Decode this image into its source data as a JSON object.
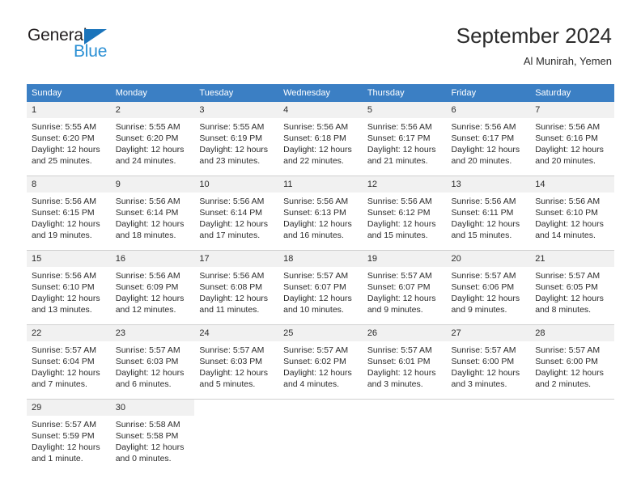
{
  "brand": {
    "name_part1": "General",
    "name_part2": "Blue",
    "triangle_color": "#1a74bb",
    "blue_color": "#2a8fd4"
  },
  "header": {
    "title": "September 2024",
    "subtitle": "Al Munirah, Yemen"
  },
  "theme": {
    "header_row_bg": "#3b7fc4",
    "daynum_bg": "#f1f1f1",
    "text_color": "#2b2b2b",
    "separator_color": "#d0d0d0"
  },
  "weekday_headers": [
    "Sunday",
    "Monday",
    "Tuesday",
    "Wednesday",
    "Thursday",
    "Friday",
    "Saturday"
  ],
  "weeks": [
    [
      {
        "day": "1",
        "sunrise": "Sunrise: 5:55 AM",
        "sunset": "Sunset: 6:20 PM",
        "daylight1": "Daylight: 12 hours",
        "daylight2": "and 25 minutes."
      },
      {
        "day": "2",
        "sunrise": "Sunrise: 5:55 AM",
        "sunset": "Sunset: 6:20 PM",
        "daylight1": "Daylight: 12 hours",
        "daylight2": "and 24 minutes."
      },
      {
        "day": "3",
        "sunrise": "Sunrise: 5:55 AM",
        "sunset": "Sunset: 6:19 PM",
        "daylight1": "Daylight: 12 hours",
        "daylight2": "and 23 minutes."
      },
      {
        "day": "4",
        "sunrise": "Sunrise: 5:56 AM",
        "sunset": "Sunset: 6:18 PM",
        "daylight1": "Daylight: 12 hours",
        "daylight2": "and 22 minutes."
      },
      {
        "day": "5",
        "sunrise": "Sunrise: 5:56 AM",
        "sunset": "Sunset: 6:17 PM",
        "daylight1": "Daylight: 12 hours",
        "daylight2": "and 21 minutes."
      },
      {
        "day": "6",
        "sunrise": "Sunrise: 5:56 AM",
        "sunset": "Sunset: 6:17 PM",
        "daylight1": "Daylight: 12 hours",
        "daylight2": "and 20 minutes."
      },
      {
        "day": "7",
        "sunrise": "Sunrise: 5:56 AM",
        "sunset": "Sunset: 6:16 PM",
        "daylight1": "Daylight: 12 hours",
        "daylight2": "and 20 minutes."
      }
    ],
    [
      {
        "day": "8",
        "sunrise": "Sunrise: 5:56 AM",
        "sunset": "Sunset: 6:15 PM",
        "daylight1": "Daylight: 12 hours",
        "daylight2": "and 19 minutes."
      },
      {
        "day": "9",
        "sunrise": "Sunrise: 5:56 AM",
        "sunset": "Sunset: 6:14 PM",
        "daylight1": "Daylight: 12 hours",
        "daylight2": "and 18 minutes."
      },
      {
        "day": "10",
        "sunrise": "Sunrise: 5:56 AM",
        "sunset": "Sunset: 6:14 PM",
        "daylight1": "Daylight: 12 hours",
        "daylight2": "and 17 minutes."
      },
      {
        "day": "11",
        "sunrise": "Sunrise: 5:56 AM",
        "sunset": "Sunset: 6:13 PM",
        "daylight1": "Daylight: 12 hours",
        "daylight2": "and 16 minutes."
      },
      {
        "day": "12",
        "sunrise": "Sunrise: 5:56 AM",
        "sunset": "Sunset: 6:12 PM",
        "daylight1": "Daylight: 12 hours",
        "daylight2": "and 15 minutes."
      },
      {
        "day": "13",
        "sunrise": "Sunrise: 5:56 AM",
        "sunset": "Sunset: 6:11 PM",
        "daylight1": "Daylight: 12 hours",
        "daylight2": "and 15 minutes."
      },
      {
        "day": "14",
        "sunrise": "Sunrise: 5:56 AM",
        "sunset": "Sunset: 6:10 PM",
        "daylight1": "Daylight: 12 hours",
        "daylight2": "and 14 minutes."
      }
    ],
    [
      {
        "day": "15",
        "sunrise": "Sunrise: 5:56 AM",
        "sunset": "Sunset: 6:10 PM",
        "daylight1": "Daylight: 12 hours",
        "daylight2": "and 13 minutes."
      },
      {
        "day": "16",
        "sunrise": "Sunrise: 5:56 AM",
        "sunset": "Sunset: 6:09 PM",
        "daylight1": "Daylight: 12 hours",
        "daylight2": "and 12 minutes."
      },
      {
        "day": "17",
        "sunrise": "Sunrise: 5:56 AM",
        "sunset": "Sunset: 6:08 PM",
        "daylight1": "Daylight: 12 hours",
        "daylight2": "and 11 minutes."
      },
      {
        "day": "18",
        "sunrise": "Sunrise: 5:57 AM",
        "sunset": "Sunset: 6:07 PM",
        "daylight1": "Daylight: 12 hours",
        "daylight2": "and 10 minutes."
      },
      {
        "day": "19",
        "sunrise": "Sunrise: 5:57 AM",
        "sunset": "Sunset: 6:07 PM",
        "daylight1": "Daylight: 12 hours",
        "daylight2": "and 9 minutes."
      },
      {
        "day": "20",
        "sunrise": "Sunrise: 5:57 AM",
        "sunset": "Sunset: 6:06 PM",
        "daylight1": "Daylight: 12 hours",
        "daylight2": "and 9 minutes."
      },
      {
        "day": "21",
        "sunrise": "Sunrise: 5:57 AM",
        "sunset": "Sunset: 6:05 PM",
        "daylight1": "Daylight: 12 hours",
        "daylight2": "and 8 minutes."
      }
    ],
    [
      {
        "day": "22",
        "sunrise": "Sunrise: 5:57 AM",
        "sunset": "Sunset: 6:04 PM",
        "daylight1": "Daylight: 12 hours",
        "daylight2": "and 7 minutes."
      },
      {
        "day": "23",
        "sunrise": "Sunrise: 5:57 AM",
        "sunset": "Sunset: 6:03 PM",
        "daylight1": "Daylight: 12 hours",
        "daylight2": "and 6 minutes."
      },
      {
        "day": "24",
        "sunrise": "Sunrise: 5:57 AM",
        "sunset": "Sunset: 6:03 PM",
        "daylight1": "Daylight: 12 hours",
        "daylight2": "and 5 minutes."
      },
      {
        "day": "25",
        "sunrise": "Sunrise: 5:57 AM",
        "sunset": "Sunset: 6:02 PM",
        "daylight1": "Daylight: 12 hours",
        "daylight2": "and 4 minutes."
      },
      {
        "day": "26",
        "sunrise": "Sunrise: 5:57 AM",
        "sunset": "Sunset: 6:01 PM",
        "daylight1": "Daylight: 12 hours",
        "daylight2": "and 3 minutes."
      },
      {
        "day": "27",
        "sunrise": "Sunrise: 5:57 AM",
        "sunset": "Sunset: 6:00 PM",
        "daylight1": "Daylight: 12 hours",
        "daylight2": "and 3 minutes."
      },
      {
        "day": "28",
        "sunrise": "Sunrise: 5:57 AM",
        "sunset": "Sunset: 6:00 PM",
        "daylight1": "Daylight: 12 hours",
        "daylight2": "and 2 minutes."
      }
    ],
    [
      {
        "day": "29",
        "sunrise": "Sunrise: 5:57 AM",
        "sunset": "Sunset: 5:59 PM",
        "daylight1": "Daylight: 12 hours",
        "daylight2": "and 1 minute."
      },
      {
        "day": "30",
        "sunrise": "Sunrise: 5:58 AM",
        "sunset": "Sunset: 5:58 PM",
        "daylight1": "Daylight: 12 hours",
        "daylight2": "and 0 minutes."
      },
      {
        "day": "",
        "sunrise": "",
        "sunset": "",
        "daylight1": "",
        "daylight2": ""
      },
      {
        "day": "",
        "sunrise": "",
        "sunset": "",
        "daylight1": "",
        "daylight2": ""
      },
      {
        "day": "",
        "sunrise": "",
        "sunset": "",
        "daylight1": "",
        "daylight2": ""
      },
      {
        "day": "",
        "sunrise": "",
        "sunset": "",
        "daylight1": "",
        "daylight2": ""
      },
      {
        "day": "",
        "sunrise": "",
        "sunset": "",
        "daylight1": "",
        "daylight2": ""
      }
    ]
  ]
}
